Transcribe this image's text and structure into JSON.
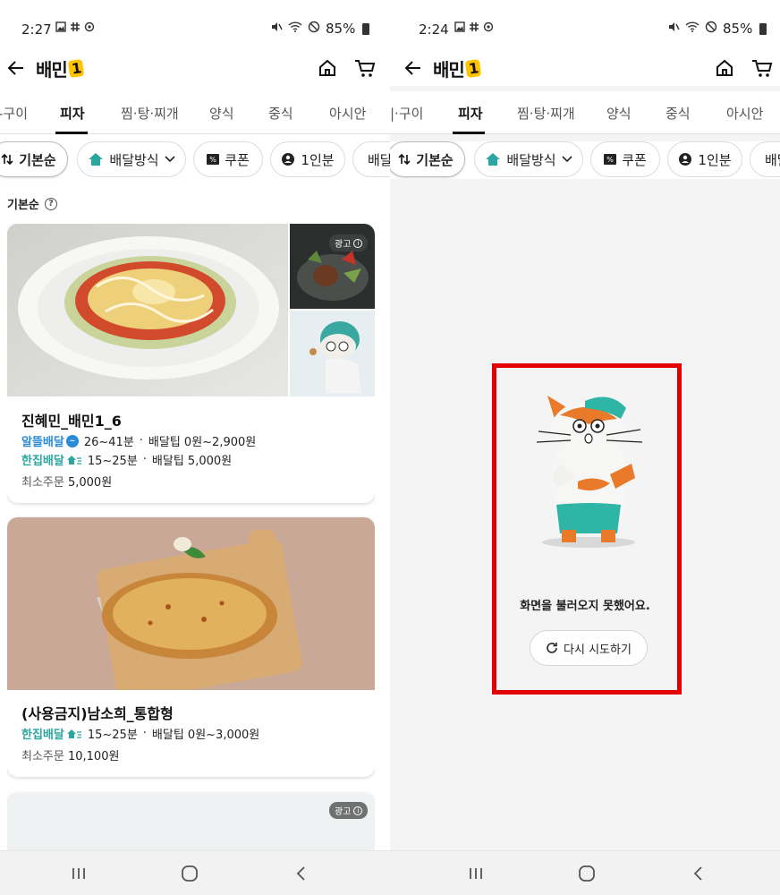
{
  "left": {
    "status": {
      "time": "2:27",
      "battery": "85%"
    },
    "appbar": {
      "logo": "배민",
      "logo_badge": "1"
    },
    "tabs": [
      {
        "label": "-구이"
      },
      {
        "label": "피자"
      },
      {
        "label": "찜·탕·찌개"
      },
      {
        "label": "양식"
      },
      {
        "label": "중식"
      },
      {
        "label": "아시안"
      }
    ],
    "active_tab": "피자",
    "chips": [
      {
        "label": "기본순",
        "icon": "sort-icon"
      },
      {
        "label": "배달방식",
        "icon": "delivery-house-icon"
      },
      {
        "label": "쿠폰",
        "icon": "coupon-icon"
      },
      {
        "label": "1인분",
        "icon": "single-serving-icon"
      },
      {
        "label": "배달"
      }
    ],
    "sort_label": "기본순",
    "ad_label": "광고",
    "stores": [
      {
        "name": "진혜민_배민1_6",
        "rows": [
          {
            "type": "알뜰배달",
            "time": "26~41분",
            "tip": "배달팁 0원~2,900원"
          },
          {
            "type": "한집배달",
            "time": "15~25분",
            "tip": "배달팁 5,000원"
          }
        ],
        "min_order_label": "최소주문",
        "min_order": "5,000원"
      },
      {
        "name": "(사용금지)남소희_통합형",
        "rows": [
          {
            "type": "한집배달",
            "time": "15~25분",
            "tip": "배달팁 0원~3,000원"
          }
        ],
        "min_order_label": "최소주문",
        "min_order": "10,100원"
      }
    ]
  },
  "right": {
    "status": {
      "time": "2:24",
      "battery": "85%"
    },
    "appbar": {
      "logo": "배민",
      "logo_badge": "1"
    },
    "tabs": [
      {
        "label": "|·구이"
      },
      {
        "label": "피자"
      },
      {
        "label": "찜·탕·찌개"
      },
      {
        "label": "양식"
      },
      {
        "label": "중식"
      },
      {
        "label": "아시안"
      }
    ],
    "active_tab": "피자",
    "chips": [
      {
        "label": "기본순",
        "icon": "sort-icon"
      },
      {
        "label": "배달방식",
        "icon": "delivery-house-icon"
      },
      {
        "label": "쿠폰",
        "icon": "coupon-icon"
      },
      {
        "label": "1인분",
        "icon": "single-serving-icon"
      },
      {
        "label": "배달"
      }
    ],
    "error": {
      "message": "화면을 불러오지 못했어요.",
      "retry_label": "다시 시도하기"
    }
  },
  "colors": {
    "highlight": "#e30000",
    "alttle_blue": "#2a8cd8",
    "hanjip_teal": "#2aa5a0",
    "logo_yellow": "#ffc400"
  }
}
